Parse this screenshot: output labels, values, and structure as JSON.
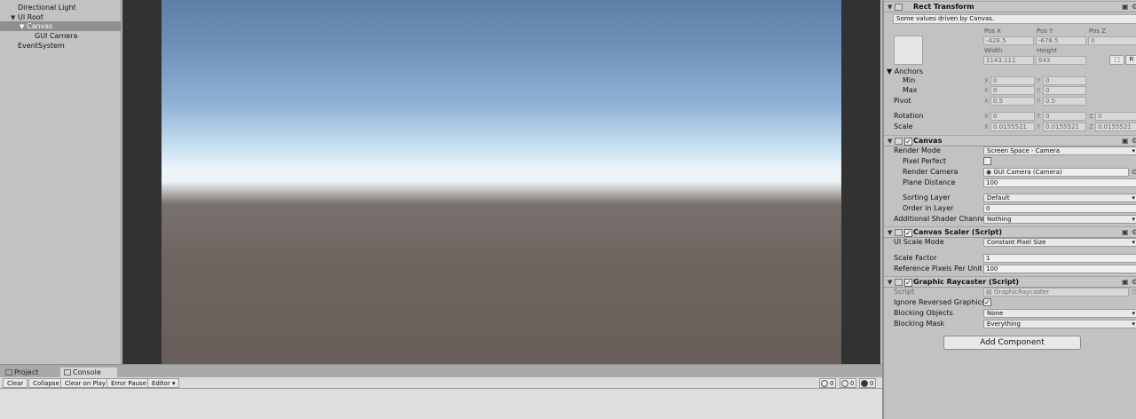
{
  "hierarchy": {
    "items": [
      {
        "label": "Directional Light",
        "expanded": false
      },
      {
        "label": "UI Root",
        "expanded": true
      },
      {
        "label": "Canvas",
        "expanded": true,
        "selected": true
      },
      {
        "label": "GUI Camera",
        "expanded": false
      },
      {
        "label": "EventSystem",
        "expanded": false
      }
    ]
  },
  "bottom": {
    "tabs": [
      {
        "label": "Project"
      },
      {
        "label": "Console"
      }
    ],
    "toolbar": {
      "clear": "Clear",
      "collapse": "Collapse",
      "clear_on_play": "Clear on Play",
      "error_pause": "Error Pause",
      "editor": "Editor",
      "info_count": "0",
      "warning_count": "0",
      "error_count": "0"
    }
  },
  "inspector": {
    "rect_transform": {
      "title": "Rect Transform",
      "note": "Some values driven by Canvas.",
      "pos_x_label": "Pos X",
      "pos_y_label": "Pos Y",
      "pos_z_label": "Pos Z",
      "pos_x": "-428.5",
      "pos_y": "-678.5",
      "pos_z": "0",
      "width_label": "Width",
      "height_label": "Height",
      "width": "1143.111",
      "height": "643",
      "r_button": "R",
      "anchors_label": "Anchors",
      "min_label": "Min",
      "max_label": "Max",
      "min_x": "0",
      "min_y": "0",
      "max_x": "0",
      "max_y": "0",
      "pivot_label": "Pivot",
      "pivot_x": "0.5",
      "pivot_y": "0.5",
      "rotation_label": "Rotation",
      "rot_x": "0",
      "rot_y": "0",
      "rot_z": "0",
      "scale_label": "Scale",
      "scale_x": "0.0155521",
      "scale_y": "0.0155521",
      "scale_z": "0.0155521",
      "x": "X",
      "y": "Y",
      "z": "Z"
    },
    "canvas": {
      "title": "Canvas",
      "render_mode_label": "Render Mode",
      "render_mode": "Screen Space - Camera",
      "pixel_perfect_label": "Pixel Perfect",
      "render_camera_label": "Render Camera",
      "render_camera": "GUI Camera (Camera)",
      "plane_distance_label": "Plane Distance",
      "plane_distance": "100",
      "sorting_layer_label": "Sorting Layer",
      "sorting_layer": "Default",
      "order_in_layer_label": "Order in Layer",
      "order_in_layer": "0",
      "shader_channel_label": "Additional Shader Channel",
      "shader_channel": "Nothing"
    },
    "canvas_scaler": {
      "title": "Canvas Scaler (Script)",
      "ui_scale_mode_label": "UI Scale Mode",
      "ui_scale_mode": "Constant Pixel Size",
      "scale_factor_label": "Scale Factor",
      "scale_factor": "1",
      "ref_ppu_label": "Reference Pixels Per Unit",
      "ref_ppu": "100"
    },
    "graphic_raycaster": {
      "title": "Graphic Raycaster (Script)",
      "script_label": "Script",
      "script": "GraphicRaycaster",
      "ignore_reversed_label": "Ignore Reversed Graphics",
      "blocking_objects_label": "Blocking Objects",
      "blocking_objects": "None",
      "blocking_mask_label": "Blocking Mask",
      "blocking_mask": "Everything"
    },
    "add_component": "Add Component"
  }
}
